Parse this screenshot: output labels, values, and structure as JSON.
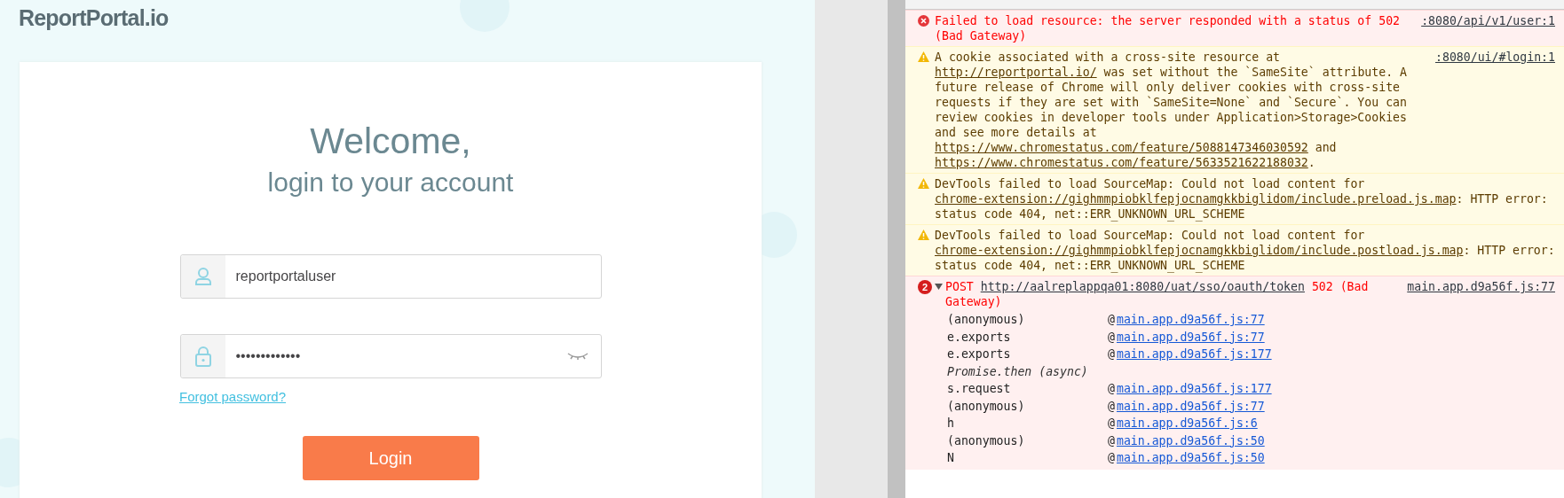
{
  "header": {
    "logo": "ReportPortal.io"
  },
  "login_form": {
    "title": "Welcome,",
    "subtitle": "login to your account",
    "fields": [
      {
        "kind": "text",
        "value": "reportportaluser"
      },
      {
        "kind": "password",
        "value": "•••••••••••••"
      }
    ],
    "forgot_link": "Forgot password?",
    "submit_button": "Login"
  },
  "console": {
    "messages": [
      {
        "kind": "error",
        "segments": [
          {
            "kind": "plain",
            "text": "Failed to load resource: the server responded with a status of 502 (Bad Gateway)"
          }
        ],
        "source": ":8080/api/v1/user:1"
      },
      {
        "kind": "warning",
        "segments": [
          {
            "kind": "plain",
            "text": "A cookie associated with a cross-site resource at "
          },
          {
            "kind": "link",
            "text": "http://reportportal.io/"
          },
          {
            "kind": "plain",
            "text": " was set without the `SameSite` attribute. A future release of Chrome will only deliver cookies with cross-site requests if they are set with `SameSite=None` and `Secure`. You can review cookies in developer tools under Application>Storage>Cookies and see more details at "
          },
          {
            "kind": "link",
            "text": "https://www.chromestatus.com/feature/5088147346030592"
          },
          {
            "kind": "plain",
            "text": " and "
          },
          {
            "kind": "link",
            "text": "https://www.chromestatus.com/feature/5633521622188032"
          },
          {
            "kind": "plain",
            "text": "."
          }
        ],
        "source": ":8080/ui/#login:1"
      },
      {
        "kind": "warning",
        "segments": [
          {
            "kind": "plain",
            "text": "DevTools failed to load SourceMap: Could not load content for "
          },
          {
            "kind": "link",
            "text": "chrome-extension://gighmmpiobklfepjocnamgkkbiglidom/include.preload.js.map"
          },
          {
            "kind": "plain",
            "text": ": HTTP error: status code 404, net::ERR_UNKNOWN_URL_SCHEME"
          }
        ]
      },
      {
        "kind": "warning",
        "segments": [
          {
            "kind": "plain",
            "text": "DevTools failed to load SourceMap: Could not load content for "
          },
          {
            "kind": "link",
            "text": "chrome-extension://gighmmpiobklfepjocnamgkkbiglidom/include.postload.js.map"
          },
          {
            "kind": "plain",
            "text": ": HTTP error: status code 404, net::ERR_UNKNOWN_URL_SCHEME"
          }
        ]
      },
      {
        "kind": "error",
        "count": "2",
        "expanded": true,
        "segments": [
          {
            "kind": "plain",
            "text": "POST "
          },
          {
            "kind": "link",
            "text": "http://aalreplappqa01:8080/uat/sso/oauth/token"
          },
          {
            "kind": "plain",
            "text": " 502 (Bad Gateway)"
          }
        ],
        "source": "main.app.d9a56f.js:77",
        "stack": [
          {
            "kind": "frame",
            "function": "(anonymous)",
            "at": "@",
            "location": "main.app.d9a56f.js:77"
          },
          {
            "kind": "frame",
            "function": "e.exports",
            "at": "@",
            "location": "main.app.d9a56f.js:77"
          },
          {
            "kind": "frame",
            "function": "e.exports",
            "at": "@",
            "location": "main.app.d9a56f.js:177"
          },
          {
            "kind": "async",
            "label": "Promise.then (async)"
          },
          {
            "kind": "frame",
            "function": "s.request",
            "at": "@",
            "location": "main.app.d9a56f.js:177"
          },
          {
            "kind": "frame",
            "function": "(anonymous)",
            "at": "@",
            "location": "main.app.d9a56f.js:77"
          },
          {
            "kind": "frame",
            "function": "h",
            "at": "@",
            "location": "main.app.d9a56f.js:6"
          },
          {
            "kind": "frame",
            "function": "(anonymous)",
            "at": "@",
            "location": "main.app.d9a56f.js:50"
          },
          {
            "kind": "frame",
            "function": "N",
            "at": "@",
            "location": "main.app.d9a56f.js:50"
          }
        ]
      }
    ]
  }
}
